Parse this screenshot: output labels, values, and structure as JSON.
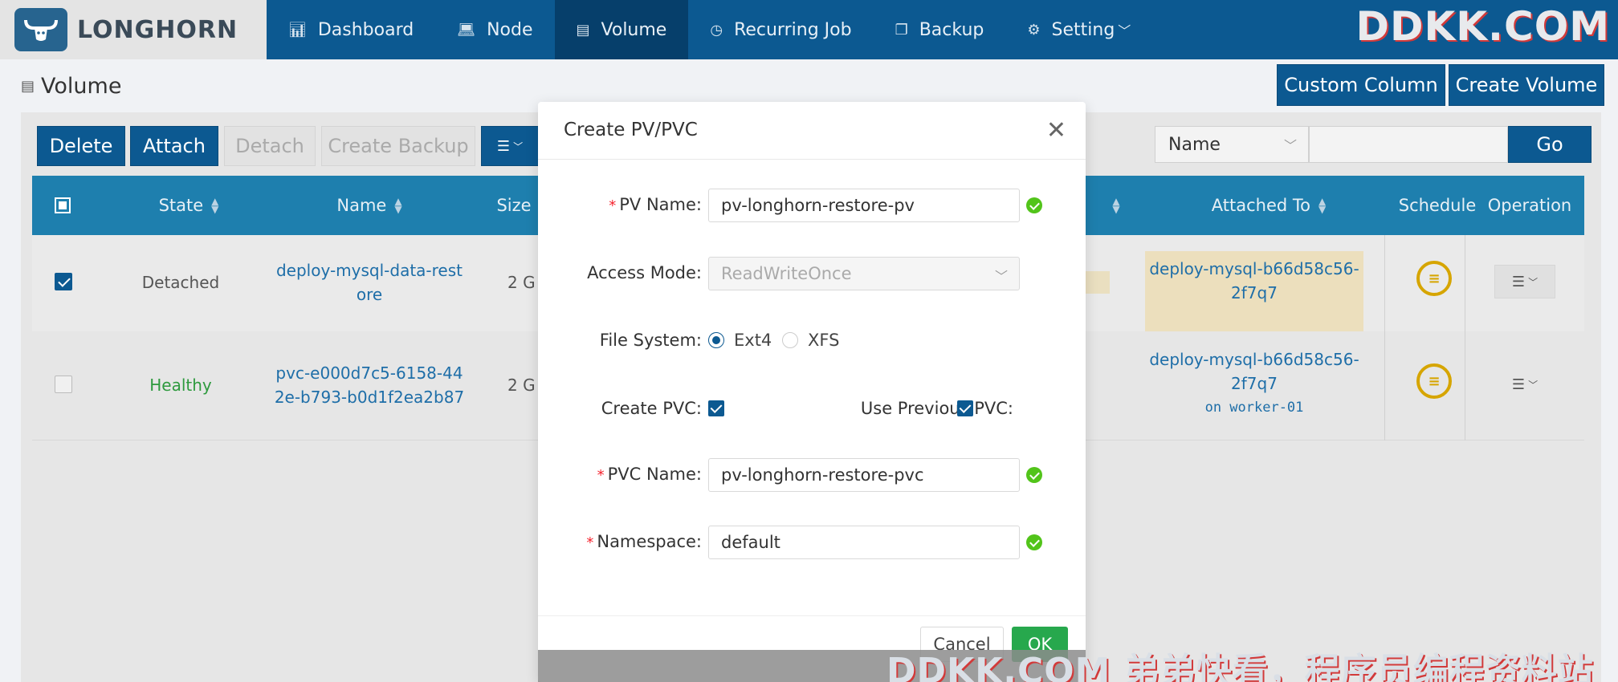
{
  "app": {
    "logo_text": "LONGHORN",
    "watermark": "DDKK.COM",
    "footer_watermark": "DDKK.COM 弟弟快看，程序员编程资料站"
  },
  "nav": {
    "items": [
      {
        "label": "Dashboard",
        "icon": "bar-chart-icon"
      },
      {
        "label": "Node",
        "icon": "laptop-icon"
      },
      {
        "label": "Volume",
        "icon": "database-icon"
      },
      {
        "label": "Recurring Job",
        "icon": "clock-icon"
      },
      {
        "label": "Backup",
        "icon": "copy-icon"
      },
      {
        "label": "Setting",
        "icon": "gear-icon"
      }
    ],
    "active": "Volume"
  },
  "page": {
    "title": "Volume",
    "custom_column": "Custom Column",
    "create_volume": "Create Volume"
  },
  "toolbar": {
    "delete": "Delete",
    "attach": "Attach",
    "detach": "Detach",
    "create_backup": "Create Backup",
    "filter_field": "Name",
    "go": "Go"
  },
  "table": {
    "headers": {
      "state": "State",
      "name": "Name",
      "size": "Size",
      "attached_to": "Attached To",
      "schedule": "Schedule",
      "operation": "Operation"
    },
    "rows": [
      {
        "checked": true,
        "state": "Detached",
        "name_line1": "deploy-mysql-data-rest",
        "name_line2": "ore",
        "size": "2 G",
        "attached_line1": "deploy-mysql-b66d58c56-",
        "attached_line2": "2f7q7",
        "attached_node": ""
      },
      {
        "checked": false,
        "state": "Healthy",
        "name_line1": "pvc-e000d7c5-6158-44",
        "name_line2": "2e-b793-b0d1f2ea2b87",
        "size": "2 G",
        "attached_line1": "deploy-mysql-b66d58c56-",
        "attached_line2": "2f7q7",
        "attached_node": "on worker-01"
      }
    ]
  },
  "modal": {
    "title": "Create PV/PVC",
    "pv_name_label": "PV Name:",
    "pv_name_value": "pv-longhorn-restore-pv",
    "access_mode_label": "Access Mode:",
    "access_mode_value": "ReadWriteOnce",
    "file_system_label": "File System:",
    "fs_ext4": "Ext4",
    "fs_xfs": "XFS",
    "create_pvc_label": "Create PVC:",
    "use_previous_pvc_label": "Use Previous PVC:",
    "pvc_name_label": "PVC Name:",
    "pvc_name_value": "pv-longhorn-restore-pvc",
    "namespace_label": "Namespace:",
    "namespace_value": "default",
    "cancel": "Cancel",
    "ok": "OK",
    "colors": {
      "primary": "#0c5991",
      "ok": "#27a84d",
      "valid": "#52c41a"
    }
  }
}
